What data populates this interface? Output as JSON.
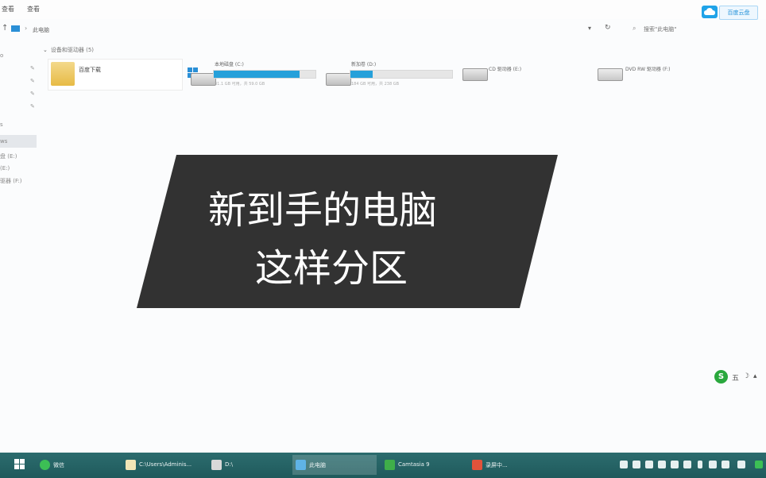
{
  "menu": {
    "items": [
      "查看",
      "查看"
    ]
  },
  "cloud": {
    "tag": "百度云盘"
  },
  "address": {
    "crumb": "此电脑",
    "search_placeholder": "搜索\"此电脑\""
  },
  "nav": {
    "items": [
      {
        "label": "s"
      },
      {
        "label": "ws"
      },
      {
        "label": "盘 (E:)"
      },
      {
        "label": "(E:)"
      },
      {
        "label": "驱器 (F:)"
      }
    ]
  },
  "section": {
    "title": "设备和驱动器 (5)"
  },
  "folder": {
    "name": "百度下载"
  },
  "drives": [
    {
      "name": "本地磁盘 (C:)",
      "fill": 0.84,
      "sub": "31.1 GB 可用，共 59.0 GB"
    },
    {
      "name": "新加卷 (D:)",
      "fill": 0.22,
      "sub": "184 GB 可用，共 238 GB"
    },
    {
      "name": "CD 驱动器 (E:)"
    },
    {
      "name": "DVD RW 驱动器 (F:)"
    }
  ],
  "overlay": {
    "line1": "新到手的电脑",
    "line2": "这样分区"
  },
  "tray_widget": {
    "letter": "S",
    "text": "五"
  },
  "taskbar": {
    "items": [
      {
        "label": "微信"
      },
      {
        "label": "C:\\Users\\Adminis..."
      },
      {
        "label": "D:\\"
      },
      {
        "label": "此电脑"
      },
      {
        "label": "Camtasia 9"
      },
      {
        "label": "录屏中..."
      }
    ]
  },
  "colors": {
    "accent": "#26a0da",
    "overlay_bg": "#323232",
    "taskbar": "#2c6c6e",
    "cloud": "#1fa3e8"
  }
}
